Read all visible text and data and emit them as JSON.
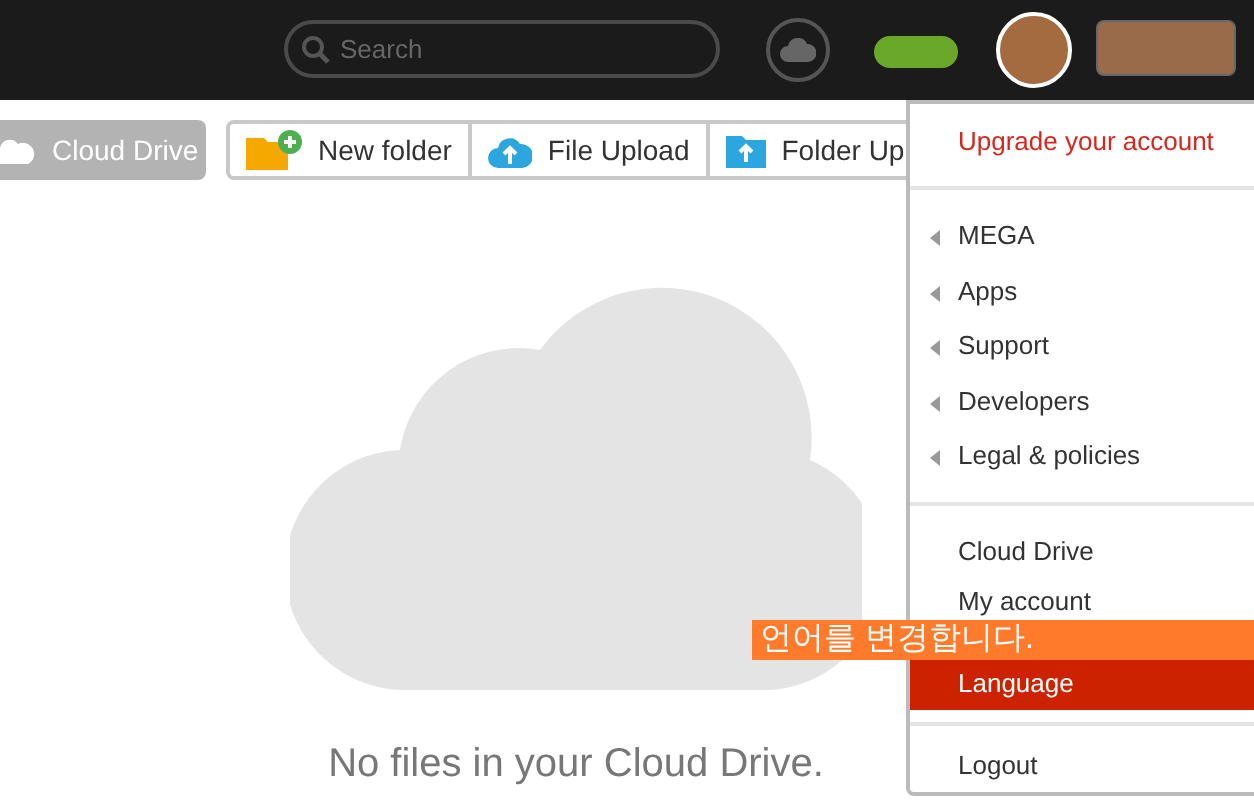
{
  "top_bar": {
    "search": {
      "placeholder": "Search"
    }
  },
  "toolbar": {
    "location": "Cloud Drive",
    "buttons": [
      {
        "label": "New folder",
        "kind": "folder"
      },
      {
        "label": "File Upload",
        "kind": "upload"
      },
      {
        "label": "Folder Up",
        "kind": "folder-upload"
      }
    ]
  },
  "empty_state": {
    "message": "No files in your Cloud Drive."
  },
  "menu": {
    "items": [
      {
        "label": "Upgrade your account",
        "kind": "upgrade",
        "selected": false
      },
      {
        "label": "MEGA",
        "kind": "submenu",
        "selected": false
      },
      {
        "label": "Apps",
        "kind": "submenu",
        "selected": false
      },
      {
        "label": "Support",
        "kind": "submenu",
        "selected": false
      },
      {
        "label": "Developers",
        "kind": "submenu",
        "selected": false
      },
      {
        "label": "Legal & policies",
        "kind": "submenu",
        "selected": false
      },
      {
        "label": "Cloud Drive",
        "kind": "link",
        "selected": false
      },
      {
        "label": "My account",
        "kind": "link",
        "selected": false
      },
      {
        "label": "Language",
        "kind": "link",
        "selected": true
      },
      {
        "label": "Logout",
        "kind": "logout",
        "selected": false
      }
    ]
  },
  "annotation": {
    "text": "언어를 변경합니다."
  }
}
